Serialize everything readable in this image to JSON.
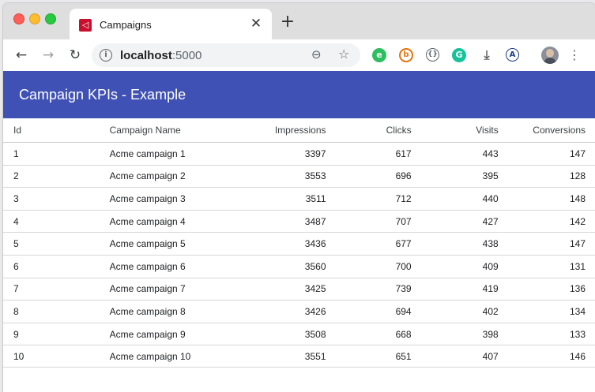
{
  "browser": {
    "tab_title": "Campaigns",
    "favicon_glyph": "◁",
    "close_glyph": "✕",
    "new_tab_glyph": "+",
    "url_host": "localhost",
    "url_port": ":5000",
    "icons": [
      "back-icon",
      "forward-icon",
      "reload-icon",
      "info-icon",
      "zoom-icon",
      "star-icon",
      "evernote-icon",
      "b-extension-icon",
      "code-extension-icon",
      "grammarly-icon",
      "download-icon",
      "a-extension-icon",
      "avatar",
      "menu-icon"
    ]
  },
  "app": {
    "title": "Campaign KPIs - Example"
  },
  "table": {
    "columns": [
      "Id",
      "Campaign Name",
      "Impressions",
      "Clicks",
      "Visits",
      "Conversions"
    ],
    "rows": [
      {
        "id": "1",
        "name": "Acme campaign 1",
        "impressions": "3397",
        "clicks": "617",
        "visits": "443",
        "conversions": "147"
      },
      {
        "id": "2",
        "name": "Acme campaign 2",
        "impressions": "3553",
        "clicks": "696",
        "visits": "395",
        "conversions": "128"
      },
      {
        "id": "3",
        "name": "Acme campaign 3",
        "impressions": "3511",
        "clicks": "712",
        "visits": "440",
        "conversions": "148"
      },
      {
        "id": "4",
        "name": "Acme campaign 4",
        "impressions": "3487",
        "clicks": "707",
        "visits": "427",
        "conversions": "142"
      },
      {
        "id": "5",
        "name": "Acme campaign 5",
        "impressions": "3436",
        "clicks": "677",
        "visits": "438",
        "conversions": "147"
      },
      {
        "id": "6",
        "name": "Acme campaign 6",
        "impressions": "3560",
        "clicks": "700",
        "visits": "409",
        "conversions": "131"
      },
      {
        "id": "7",
        "name": "Acme campaign 7",
        "impressions": "3425",
        "clicks": "739",
        "visits": "419",
        "conversions": "136"
      },
      {
        "id": "8",
        "name": "Acme campaign 8",
        "impressions": "3426",
        "clicks": "694",
        "visits": "402",
        "conversions": "134"
      },
      {
        "id": "9",
        "name": "Acme campaign 9",
        "impressions": "3508",
        "clicks": "668",
        "visits": "398",
        "conversions": "133"
      },
      {
        "id": "10",
        "name": "Acme campaign 10",
        "impressions": "3551",
        "clicks": "651",
        "visits": "407",
        "conversions": "146"
      }
    ]
  },
  "colors": {
    "header_bg": "#3f51b5",
    "header_text": "#ffffff"
  }
}
